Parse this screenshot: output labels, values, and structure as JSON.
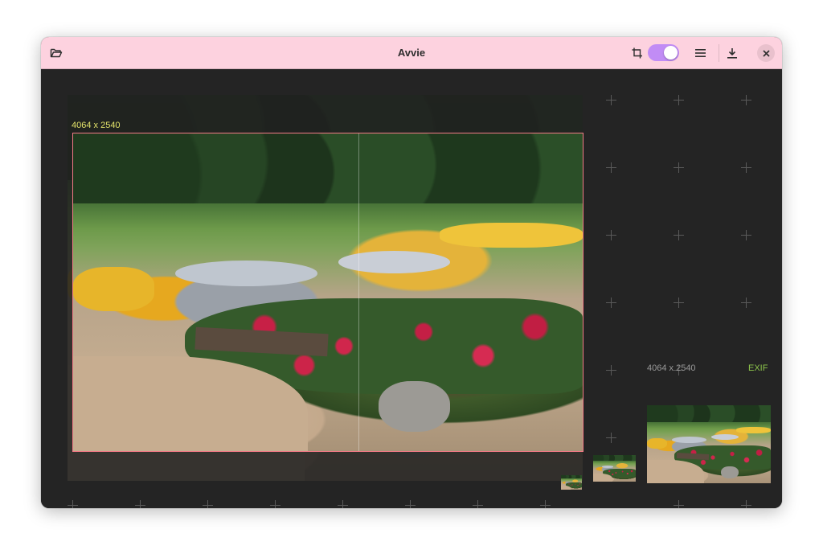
{
  "window": {
    "title": "Avvie"
  },
  "header": {
    "open_icon": "folder-open-icon",
    "crop_icon": "crop-icon",
    "crop_toggle_on": true,
    "menu_icon": "hamburger-menu-icon",
    "download_icon": "download-icon",
    "close_icon": "close-icon",
    "accent_color": "#c18cf5",
    "header_color": "#fdd2df"
  },
  "canvas": {
    "dimension_label": "4064 x 2540",
    "crop_border_color": "#f27a86",
    "dimension_label_color": "#e3e36a"
  },
  "preview": {
    "dimension_label": "4064 x 2540",
    "exif_label": "EXIF",
    "exif_color": "#8cc34b"
  }
}
